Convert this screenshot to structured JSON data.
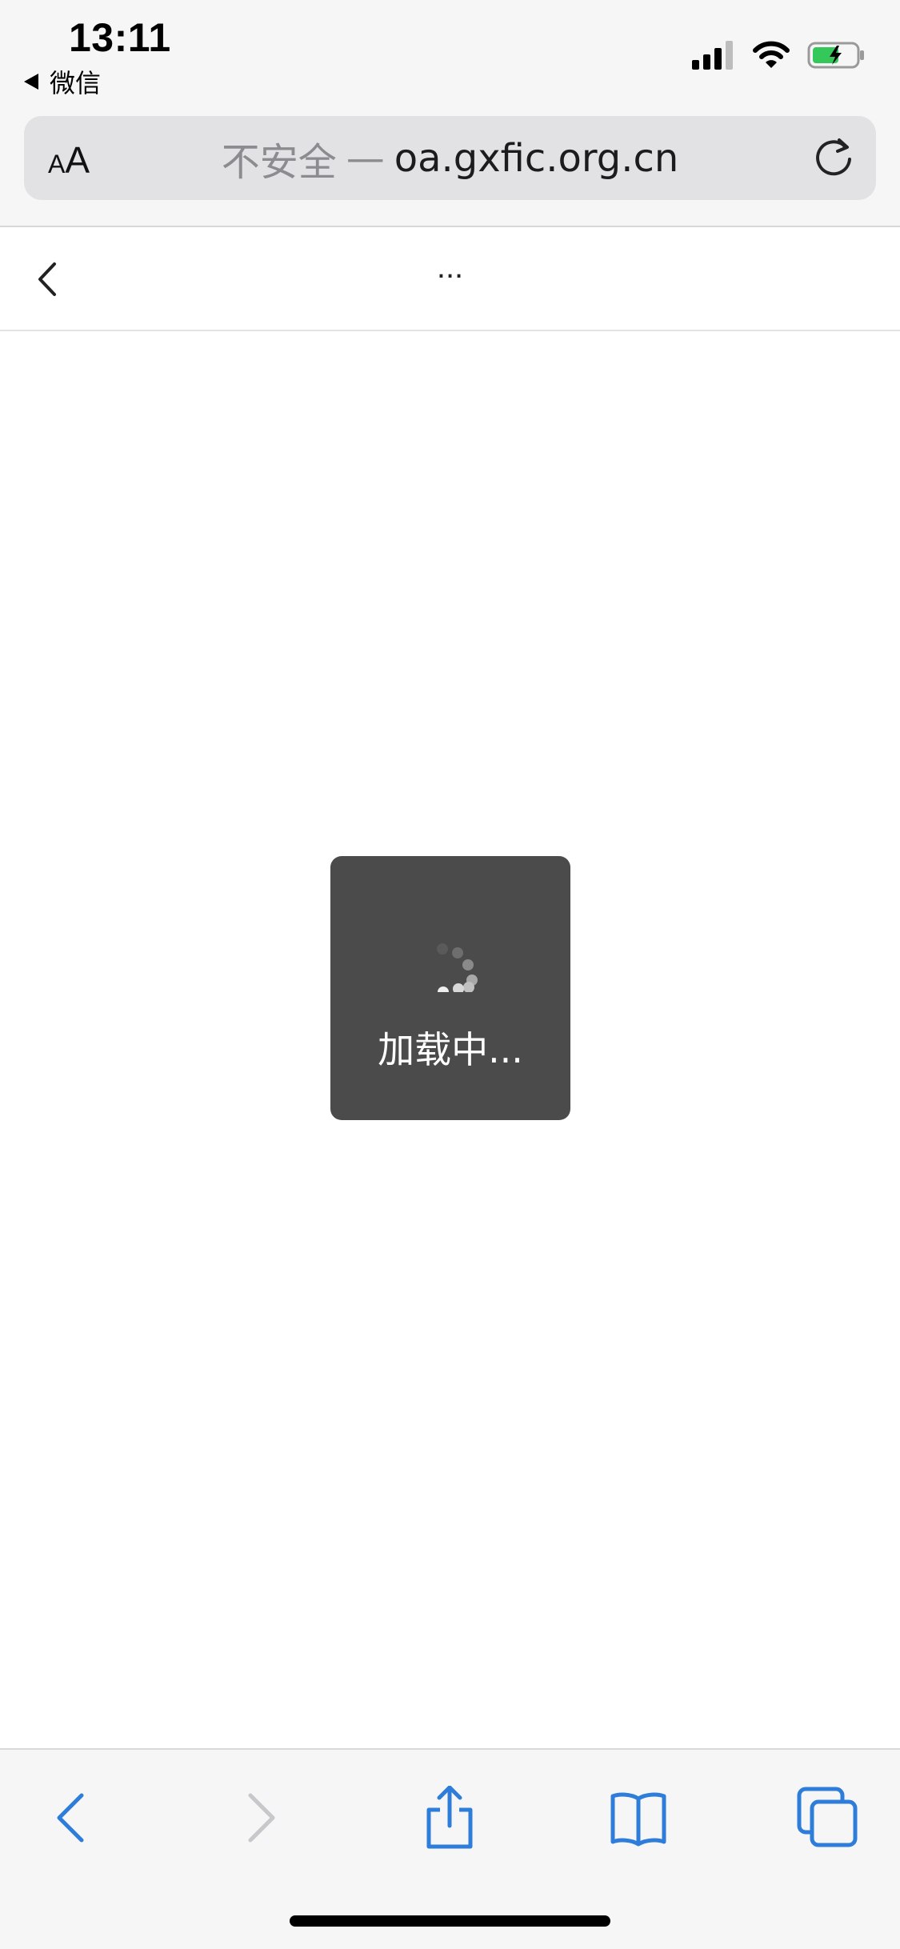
{
  "status_bar": {
    "time": "13:11",
    "back_app_label": "微信",
    "icons": [
      "cellular-signal-icon",
      "wifi-icon",
      "battery-charging-icon"
    ]
  },
  "address_bar": {
    "text_size_small": "A",
    "text_size_large": "A",
    "insecure_label": "不安全",
    "separator": "—",
    "host": "oa.gxfic.org.cn",
    "reload_icon": "reload-icon"
  },
  "page_header": {
    "back_icon": "chevron-left-icon",
    "title": "..."
  },
  "loading": {
    "text": "加载中..."
  },
  "toolbar": {
    "icons": [
      "back-icon",
      "forward-icon",
      "share-icon",
      "bookmarks-icon",
      "tabs-icon"
    ],
    "accent_color": "#2f7ddb",
    "disabled_color": "#c7c7cc"
  }
}
